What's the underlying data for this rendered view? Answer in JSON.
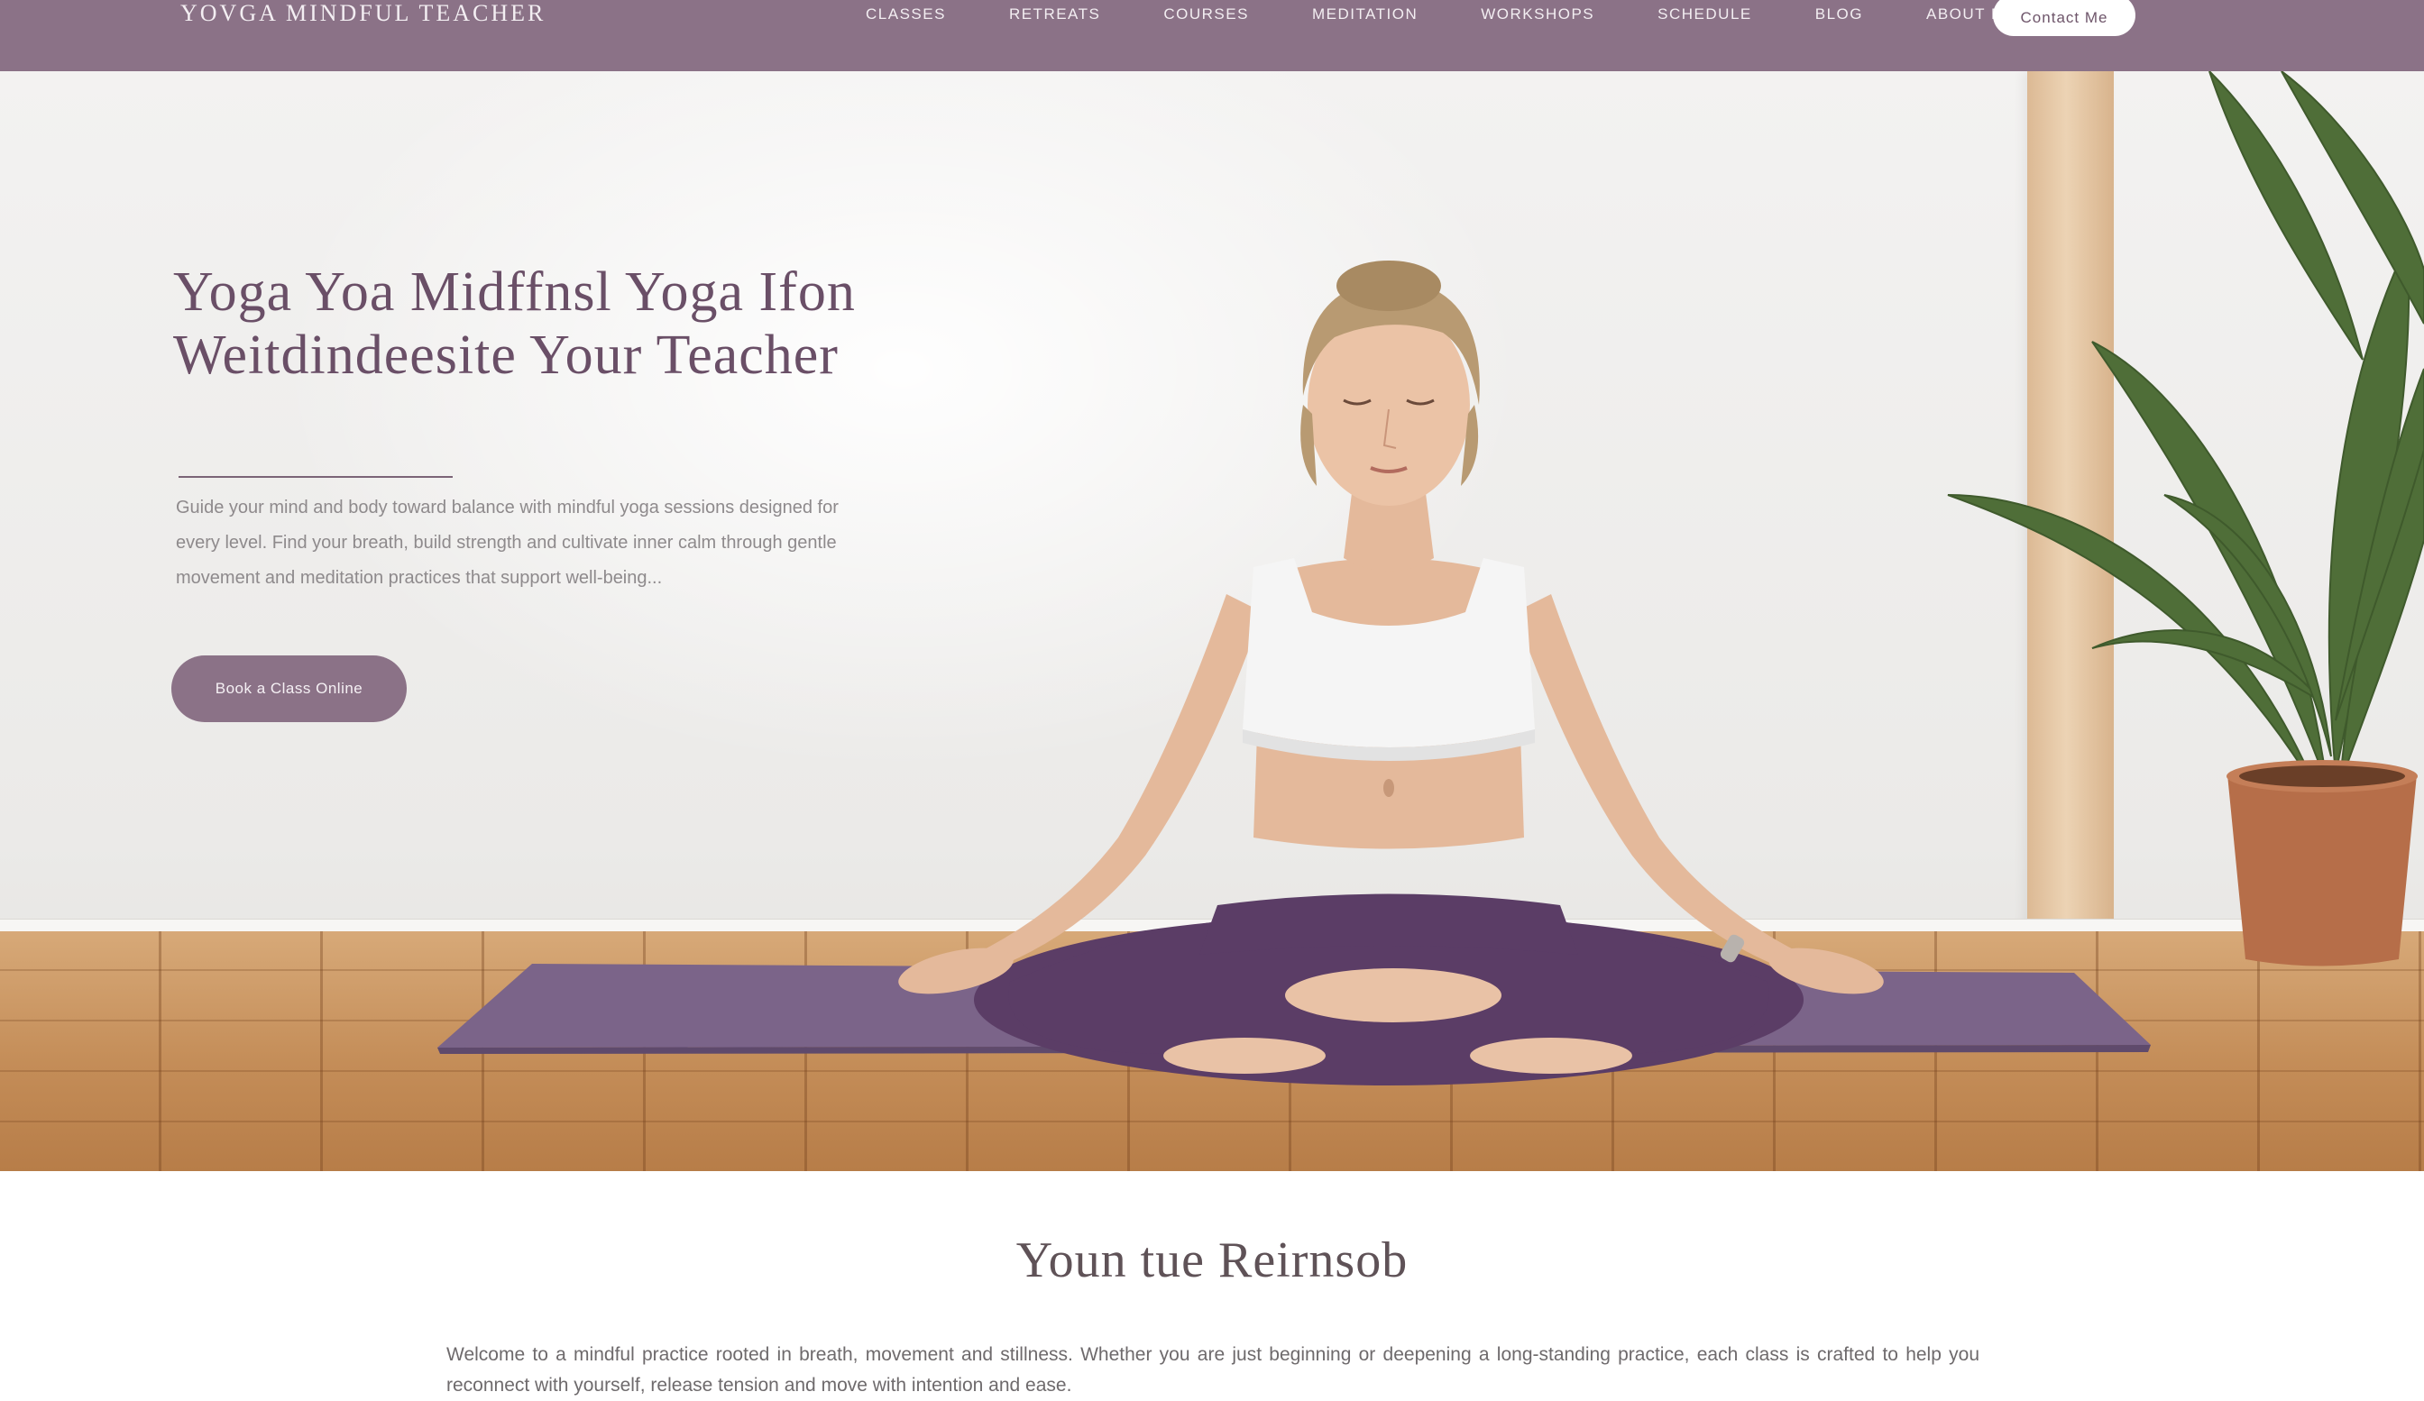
{
  "brand": "YOVGA MINDFUL TEACHER",
  "nav": {
    "links": [
      "Classes",
      "Retreats",
      "Courses",
      "Meditation",
      "Workshops",
      "Schedule",
      "Blog",
      "About Me"
    ],
    "cta_label": "Contact Me"
  },
  "hero": {
    "title": "Yoga Yoa Midffnsl Yoga Ifon Weitdindeesite Your Teacher",
    "body": "Guide your mind and body toward balance with mindful yoga sessions designed for every level. Find your breath, build strength and cultivate inner calm through gentle movement and meditation practices that support well-being...",
    "cta_label": "Book a Class Online"
  },
  "about": {
    "title": "Youn tue Reirnsob",
    "body": "Welcome to a mindful practice rooted in breath, movement and stillness. Whether you are just beginning or deepening a long-standing practice, each class is crafted to help you reconnect with yourself, release tension and move with intention and ease."
  },
  "colors": {
    "nav_bg": "#8b7287",
    "accent": "#8b7287",
    "title": "#6a4f67",
    "mat": "#7b6489",
    "leggings": "#5b3d66"
  }
}
